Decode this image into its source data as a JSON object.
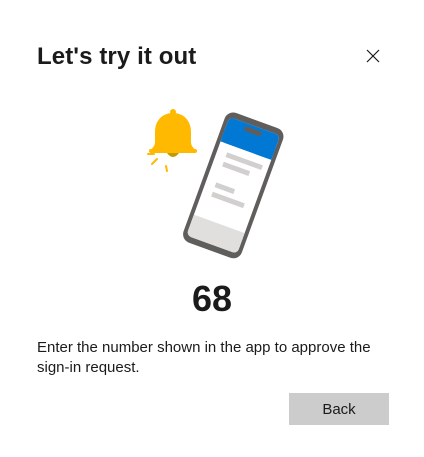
{
  "dialog": {
    "title": "Let's try it out",
    "close_icon": "close-icon",
    "illustration": {
      "bell_icon": "bell-icon",
      "phone_icon": "phone-icon",
      "colors": {
        "bell": "#FFB900",
        "phone_frame": "#605E5C",
        "phone_header": "#0078D4"
      }
    },
    "number": "68",
    "instructions": "Enter the number shown in the app to approve the sign-in request.",
    "back_label": "Back"
  }
}
